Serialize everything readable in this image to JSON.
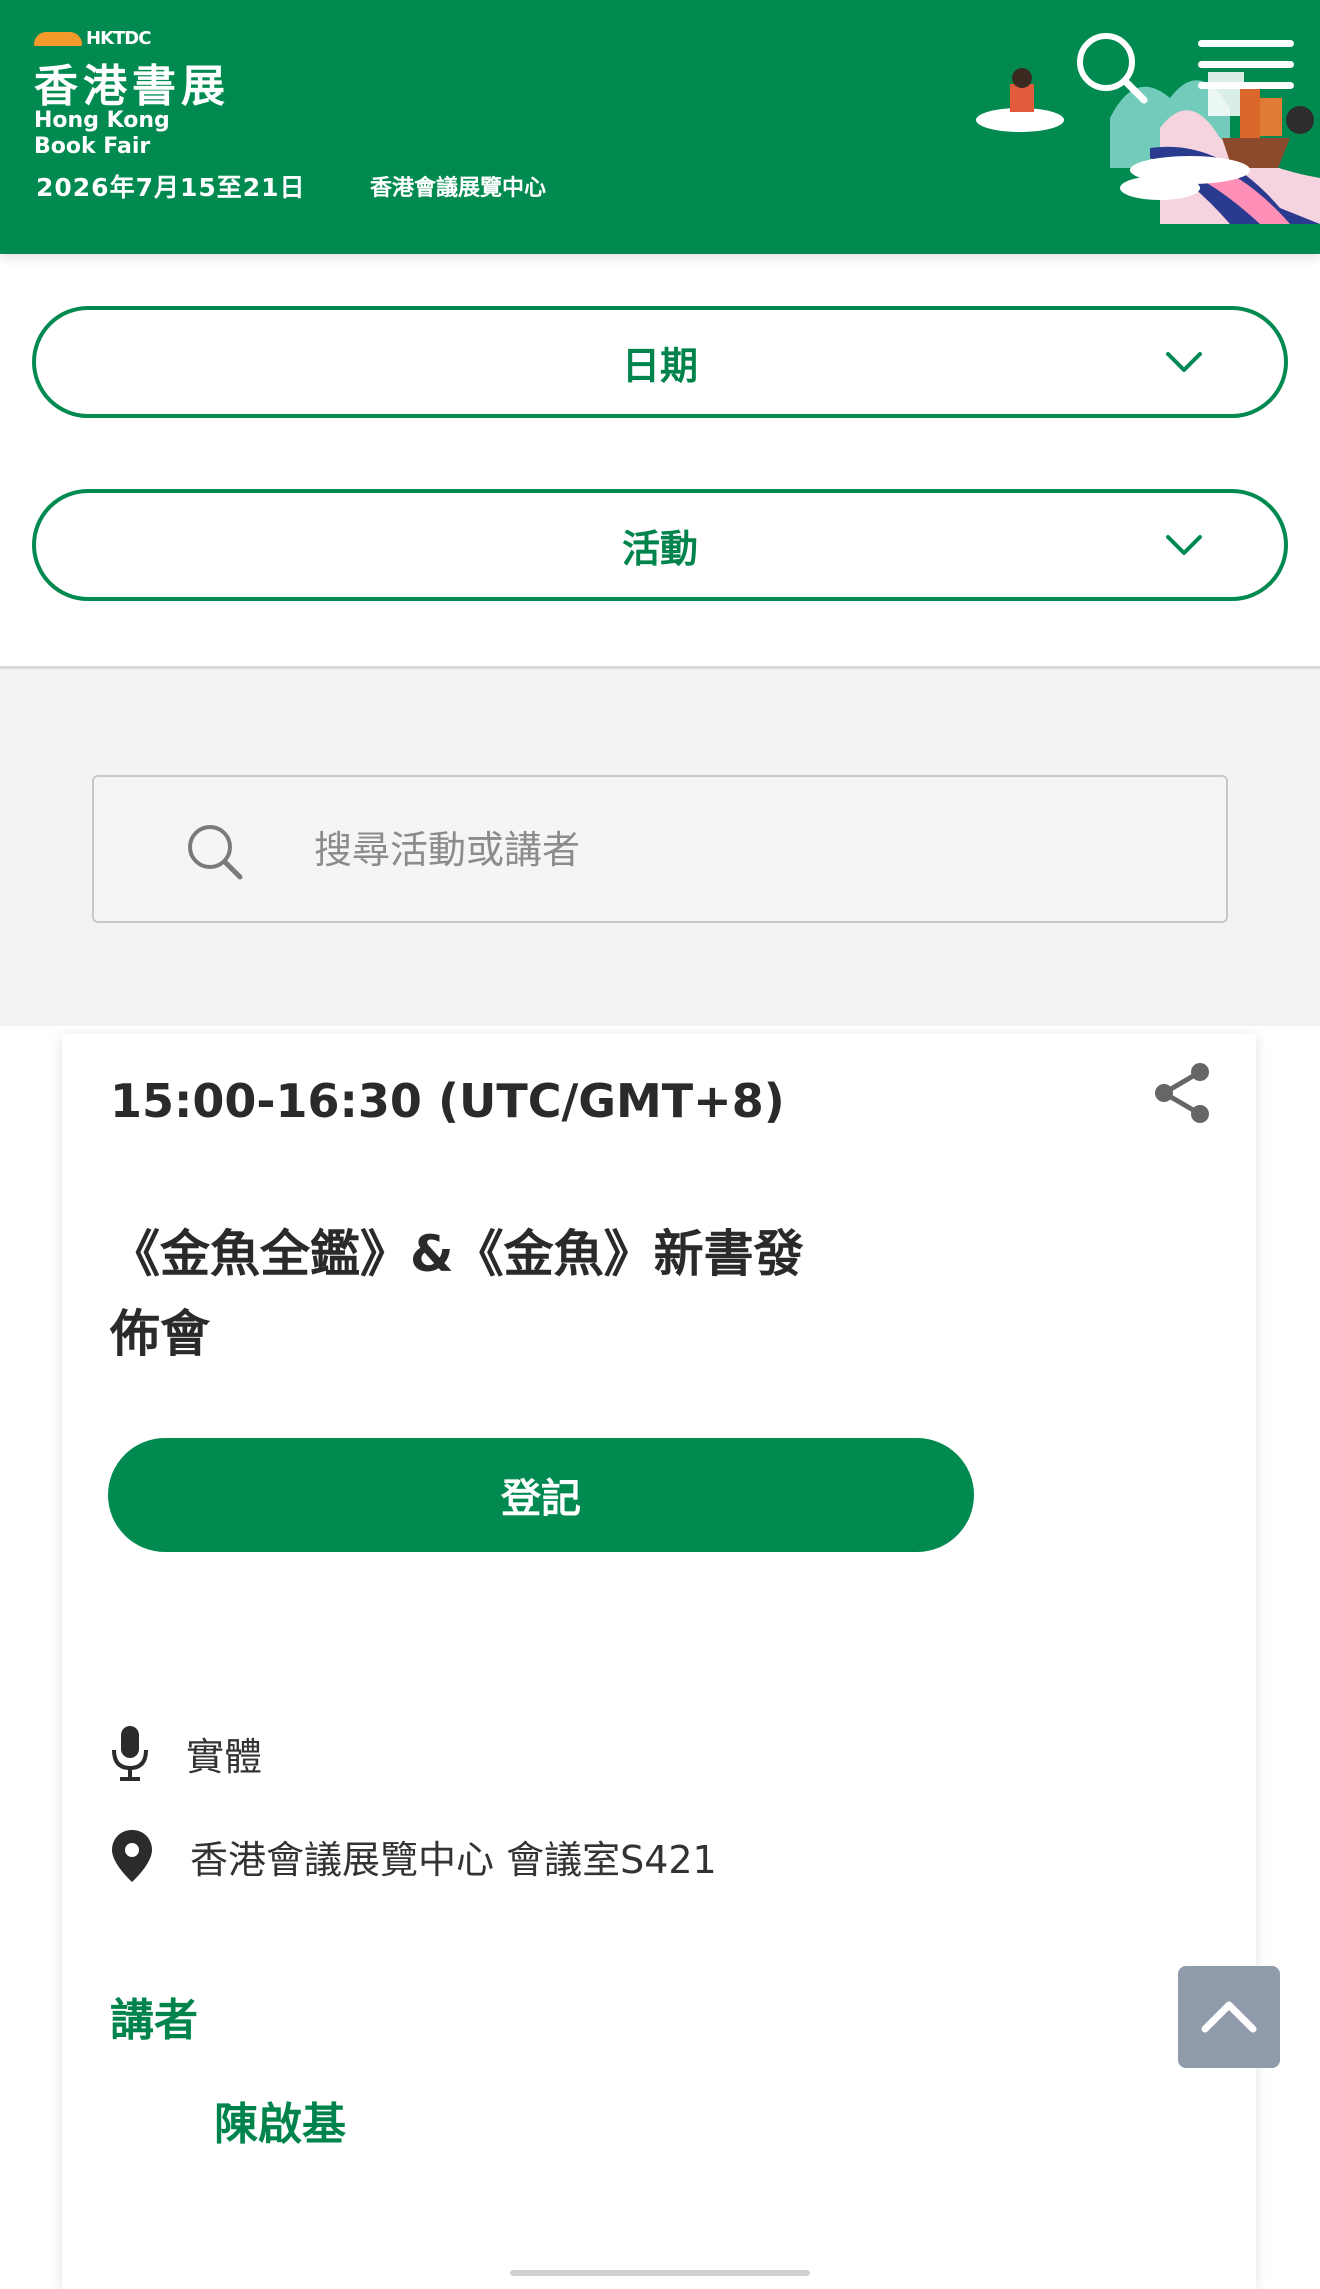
{
  "header": {
    "org": "HKTDC",
    "logo_zh": "香港書展",
    "logo_en": "Hong Kong Book Fair",
    "dates": "2026年7月15至21日",
    "venue": "香港會議展覽中心",
    "search_icon": "search-icon",
    "menu_icon": "hamburger-menu-icon"
  },
  "filters": {
    "date_label": "日期",
    "activity_label": "活動"
  },
  "search": {
    "placeholder": "搜尋活動或講者"
  },
  "event": {
    "time": "15:00-16:30 (UTC/GMT+8)",
    "title_line1": "《金魚全鑑》&《金魚》新書發",
    "title_line2": "佈會",
    "register_label": "登記",
    "mode": "實體",
    "location": "香港會議展覽中心 會議室S421",
    "speakers_heading": "講者",
    "speaker_name": "陳啟基"
  },
  "colors": {
    "brand_green": "#008a50",
    "header_accent": "#f39a2b",
    "back_to_top_bg": "#8f9aaa"
  }
}
